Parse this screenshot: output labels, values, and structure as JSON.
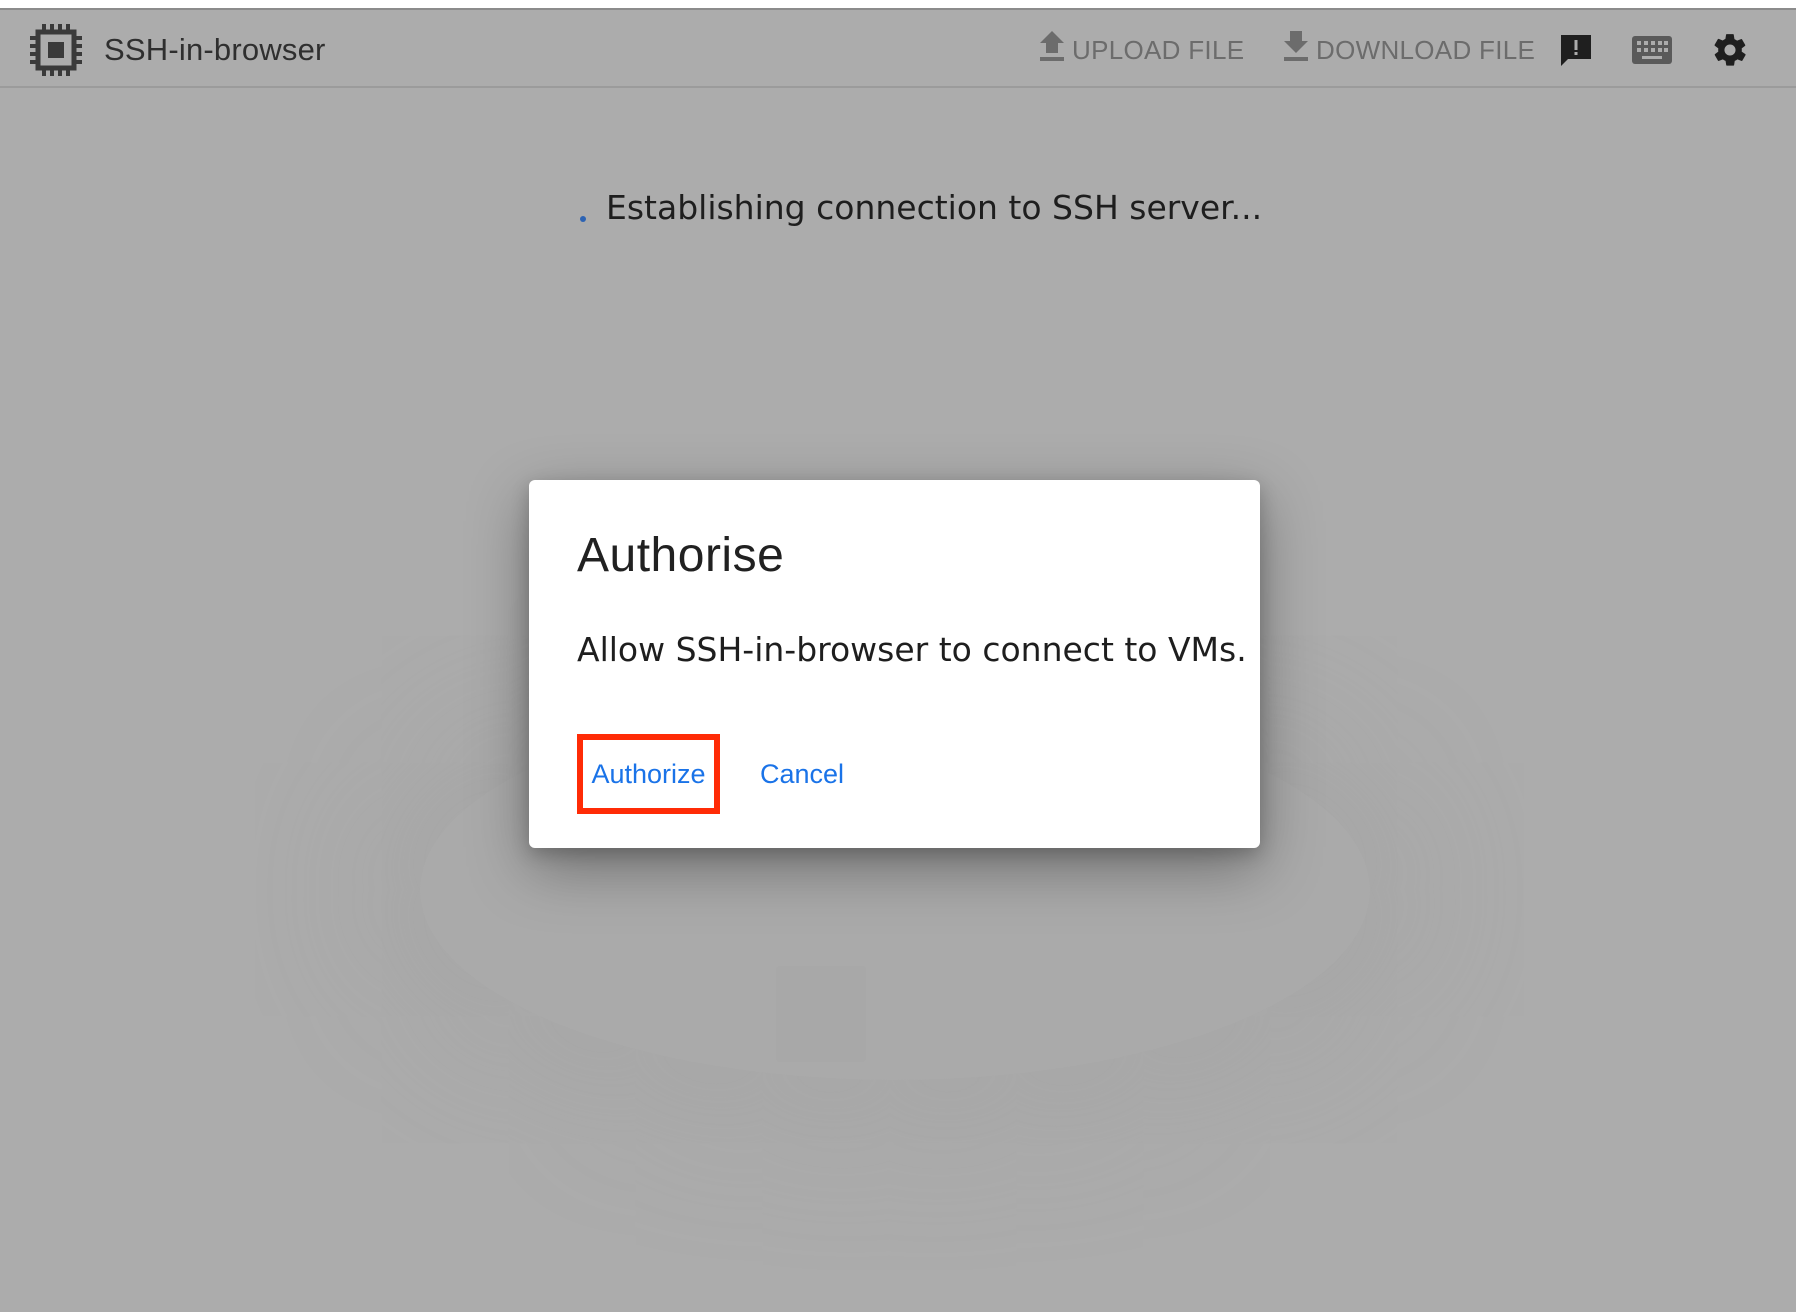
{
  "header": {
    "app_title": "SSH-in-browser",
    "upload_label": "UPLOAD FILE",
    "download_label": "DOWNLOAD FILE",
    "icons": [
      "chip-logo-icon",
      "upload-icon",
      "download-icon",
      "feedback-icon",
      "keyboard-icon",
      "gear-icon"
    ]
  },
  "status": {
    "message": "Establishing connection to SSH server..."
  },
  "dialog": {
    "title": "Authorise",
    "message": "Allow SSH-in-browser to connect to VMs.",
    "authorize_label": "Authorize",
    "cancel_label": "Cancel"
  },
  "colors": {
    "backdrop": "#acacac",
    "accent": "#1a73e8",
    "highlight": "#ff2b06"
  }
}
